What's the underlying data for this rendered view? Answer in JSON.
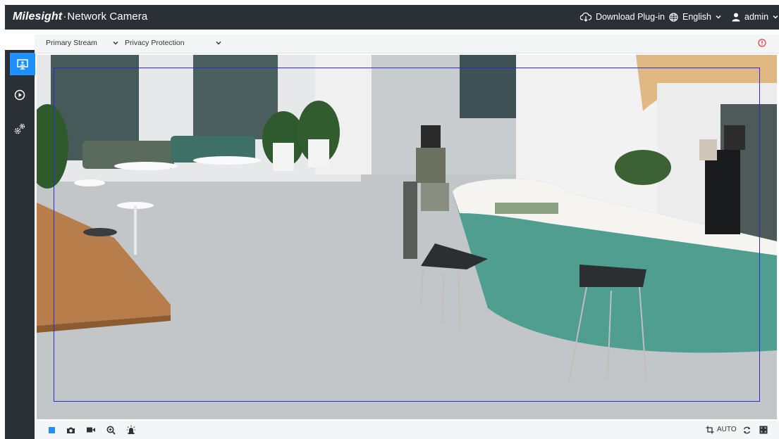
{
  "header": {
    "brand_logo": "Milesight",
    "brand_sep": "·",
    "brand_product": "Network Camera",
    "download_label": "Download Plug-in",
    "language_label": "English",
    "user_label": "admin"
  },
  "sidebar": {
    "items": [
      {
        "name": "live-view",
        "icon": "monitor-icon",
        "active": true
      },
      {
        "name": "playback",
        "icon": "play-circle-icon",
        "active": false
      },
      {
        "name": "settings",
        "icon": "gears-icon",
        "active": false
      }
    ]
  },
  "streambar": {
    "stream_value": "Primary Stream",
    "mode_value": "Privacy Protection",
    "alert_icon": "alert-circle-icon"
  },
  "toolbar": {
    "left_icons": [
      "stop-icon",
      "camera-icon",
      "record-icon",
      "zoom-in-icon",
      "alarm-icon"
    ],
    "auto_label": "AUTO",
    "right_icons": [
      "crop-icon",
      "refresh-icon",
      "fullscreen-icon"
    ]
  },
  "colors": {
    "header_bg": "#2b3036",
    "accent": "#1e90ff",
    "alert": "#e53935",
    "roi_border": "#2c2cd4"
  }
}
